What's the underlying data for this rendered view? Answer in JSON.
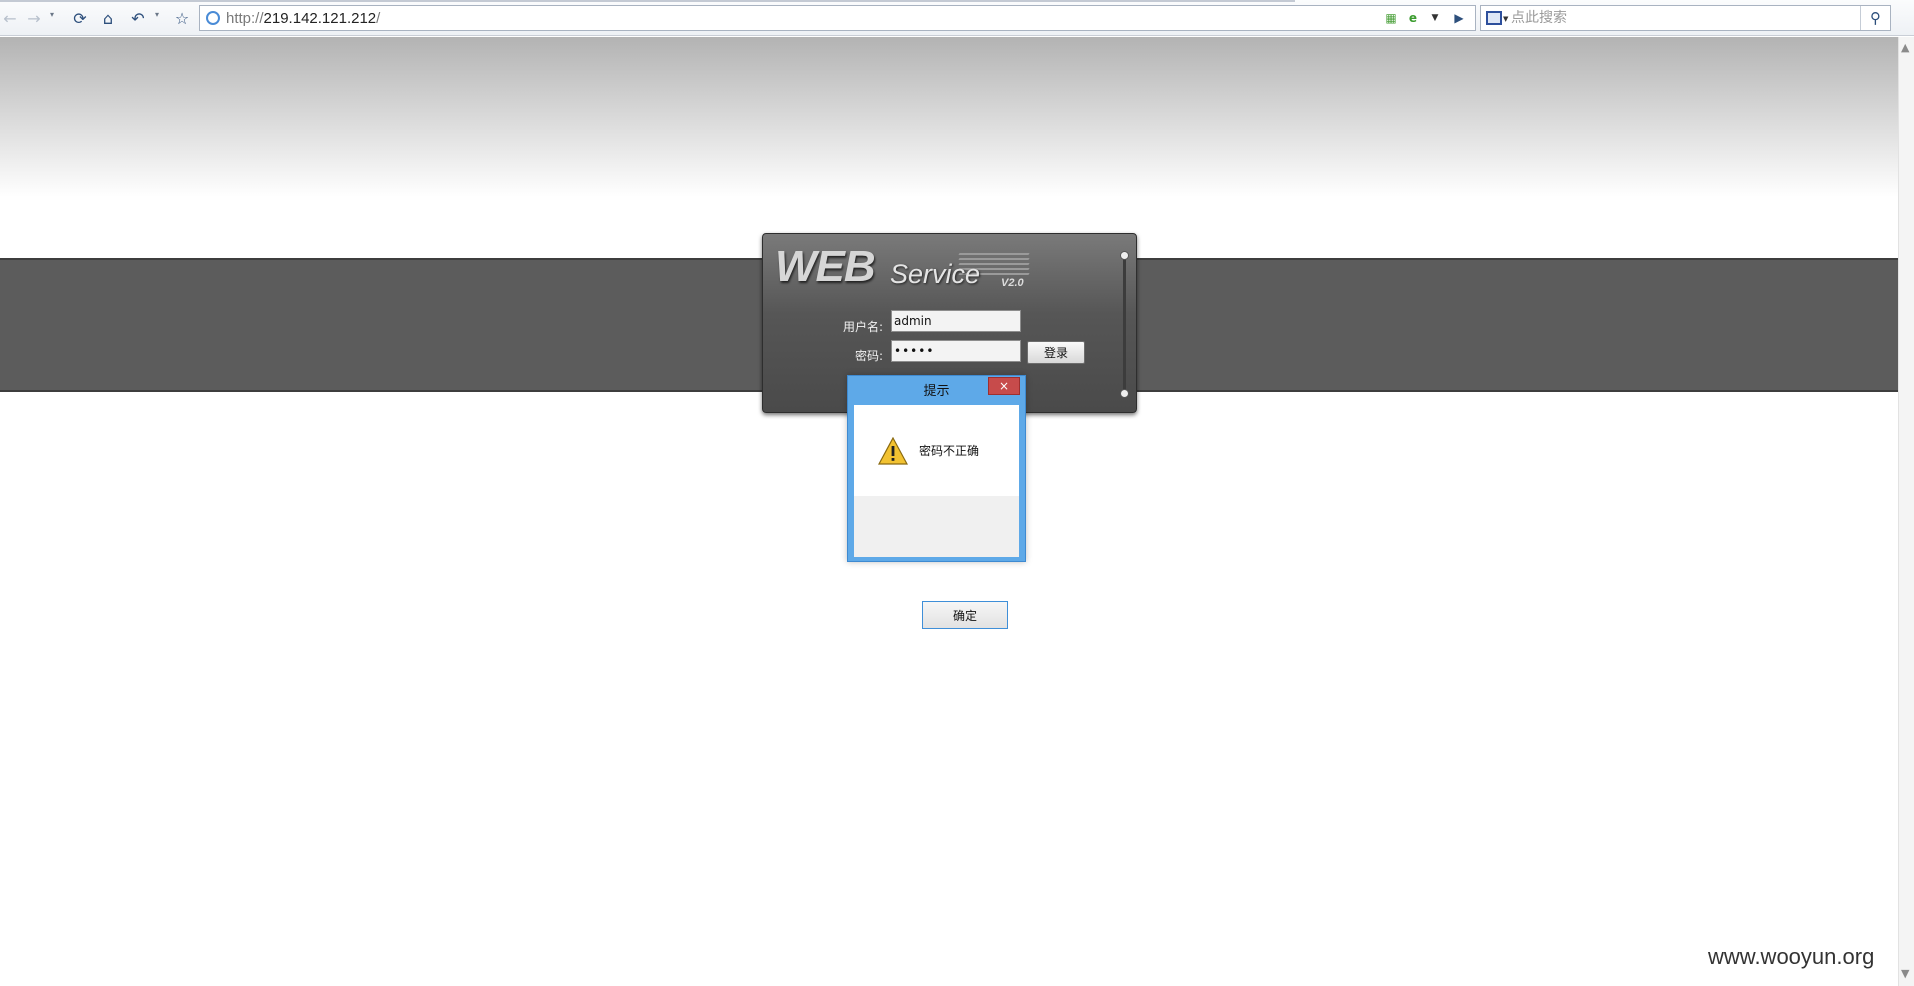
{
  "browser": {
    "url_scheme": "http://",
    "url_host": "219.142.121.212",
    "url_tail": "/",
    "search_placeholder": "点此搜索"
  },
  "login": {
    "logo_main": "WEB",
    "logo_sub": "Service",
    "logo_version": "V2.0",
    "username_label": "用户名:",
    "username_value": "admin",
    "password_label": "密码:",
    "password_value": "•••••",
    "login_button": "登录"
  },
  "dialog": {
    "title": "提示",
    "close_label": "×",
    "message": "密码不正确",
    "ok_button": "确定"
  },
  "watermark": "www.wooyun.org",
  "colors": {
    "band": "#5c5c5c",
    "dialog_frame": "#5ea9e8",
    "close_red": "#c74b4b"
  }
}
